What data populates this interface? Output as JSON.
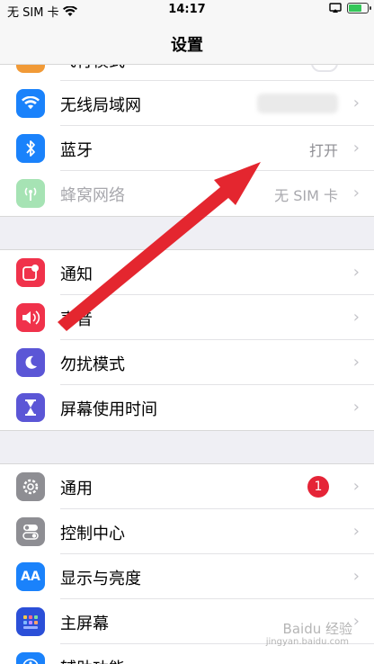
{
  "status_bar": {
    "carrier": "无 SIM 卡",
    "time": "14:17"
  },
  "nav": {
    "title": "设置"
  },
  "section1": [
    {
      "id": "airplane",
      "label": "飞行模式",
      "icon": "airplane-icon",
      "color": "#f19a37",
      "value": ""
    },
    {
      "id": "wifi",
      "label": "无线局域网",
      "icon": "wifi-icon",
      "color": "#1a82fb",
      "value": ""
    },
    {
      "id": "bluetooth",
      "label": "蓝牙",
      "icon": "bluetooth-icon",
      "color": "#1a82fb",
      "value": "打开"
    },
    {
      "id": "cellular",
      "label": "蜂窝网络",
      "icon": "antenna-icon",
      "color": "#a6e3b4",
      "value": "无 SIM 卡"
    }
  ],
  "section2": [
    {
      "id": "notifications",
      "label": "通知",
      "icon": "notification-icon",
      "color": "#f0324b"
    },
    {
      "id": "sounds",
      "label": "声音",
      "icon": "speaker-icon",
      "color": "#f0324b"
    },
    {
      "id": "dnd",
      "label": "勿扰模式",
      "icon": "moon-icon",
      "color": "#5b56d6"
    },
    {
      "id": "screentime",
      "label": "屏幕使用时间",
      "icon": "hourglass-icon",
      "color": "#5b56d6"
    }
  ],
  "section3": [
    {
      "id": "general",
      "label": "通用",
      "icon": "gear-icon",
      "color": "#8e8e93",
      "badge": "1"
    },
    {
      "id": "control",
      "label": "控制中心",
      "icon": "toggle-switches-icon",
      "color": "#8e8e93"
    },
    {
      "id": "display",
      "label": "显示与亮度",
      "icon": "display-aa-icon",
      "color": "#1a82fb",
      "icon_text": "AA"
    },
    {
      "id": "home",
      "label": "主屏幕",
      "icon": "home-grid-icon",
      "color": "#2b4fd8"
    },
    {
      "id": "accessibility",
      "label": "辅助功能",
      "icon": "accessibility-icon",
      "color": "#1a82fb"
    }
  ],
  "watermark": {
    "text": "Baidu 经验",
    "sub": "jingyan.baidu.com"
  },
  "colors": {
    "annotation_arrow": "#e4262f",
    "badge": "#e52437"
  }
}
